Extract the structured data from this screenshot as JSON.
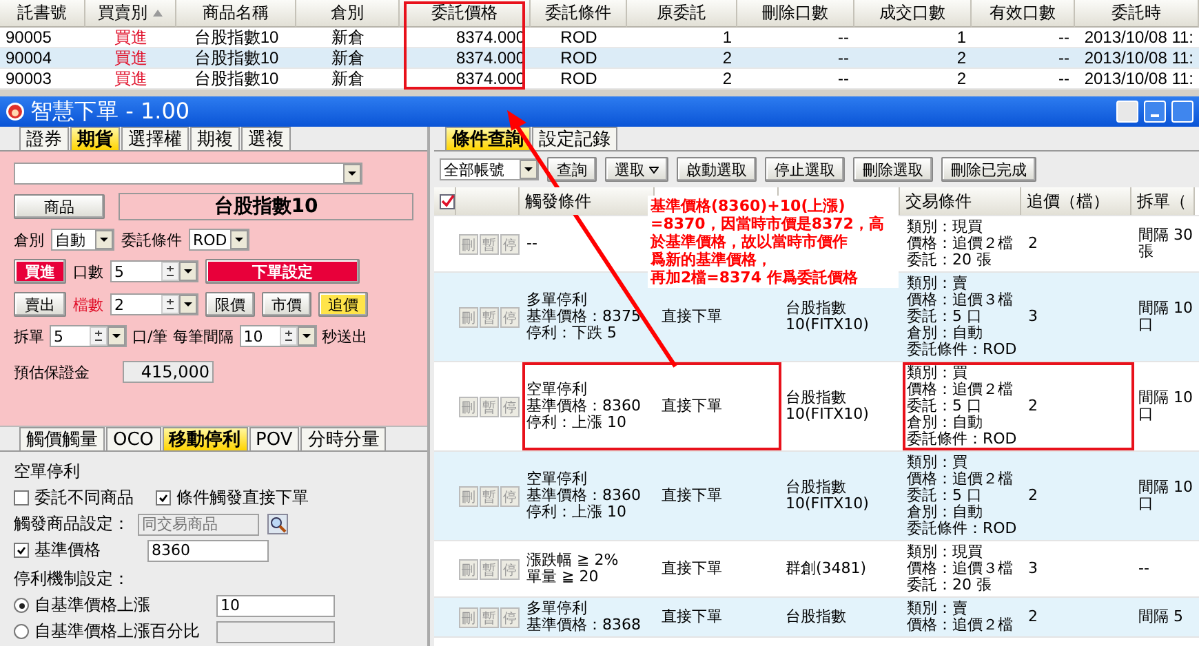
{
  "orders": {
    "columns": [
      {
        "label": "託書號",
        "highlighted": false,
        "sorted": false
      },
      {
        "label": "買賣別",
        "highlighted": false,
        "sorted": true
      },
      {
        "label": "商品名稱",
        "highlighted": false,
        "sorted": false
      },
      {
        "label": "倉別",
        "highlighted": false,
        "sorted": false
      },
      {
        "label": "委託價格",
        "highlighted": true,
        "sorted": false
      },
      {
        "label": "委託條件",
        "highlighted": false,
        "sorted": false
      },
      {
        "label": "原委託",
        "highlighted": false,
        "sorted": false
      },
      {
        "label": "刪除口數",
        "highlighted": false,
        "sorted": false
      },
      {
        "label": "成交口數",
        "highlighted": false,
        "sorted": false
      },
      {
        "label": "有效口數",
        "highlighted": false,
        "sorted": false
      },
      {
        "label": "委託時",
        "highlighted": false,
        "sorted": false
      }
    ],
    "rows": [
      {
        "selected": false,
        "cells": [
          "90005",
          "買進",
          "台股指數10",
          "新倉",
          "8374.000",
          "ROD",
          "1",
          "--",
          "1",
          "--",
          "2013/10/08 11:"
        ]
      },
      {
        "selected": true,
        "cells": [
          "90004",
          "買進",
          "台股指數10",
          "新倉",
          "8374.000",
          "ROD",
          "2",
          "--",
          "2",
          "--",
          "2013/10/08 11:"
        ]
      },
      {
        "selected": false,
        "cells": [
          "90003",
          "買進",
          "台股指數10",
          "新倉",
          "8374.000",
          "ROD",
          "2",
          "--",
          "2",
          "--",
          "2013/10/08 11:"
        ]
      }
    ]
  },
  "window": {
    "title": "智慧下單 - 1.00"
  },
  "order_panel": {
    "tabs": [
      {
        "label": "證券",
        "selected": false
      },
      {
        "label": "期貨",
        "selected": true
      },
      {
        "label": "選擇權",
        "selected": false
      },
      {
        "label": "期複",
        "selected": false
      },
      {
        "label": "選複",
        "selected": false
      }
    ],
    "product_button": "商品",
    "product_name": "台股指數10",
    "position": {
      "label": "倉別",
      "value": "自動"
    },
    "condition": {
      "label": "委託條件",
      "value": "ROD"
    },
    "sides": [
      {
        "label": "買進",
        "selected": true
      },
      {
        "label": "賣出",
        "selected": false
      }
    ],
    "quantity": {
      "label": "口數",
      "value": "5"
    },
    "ticks": {
      "label": "檔數",
      "value": "2"
    },
    "order_settings_button": "下單設定",
    "price_types": [
      {
        "label": "限價",
        "selected": false
      },
      {
        "label": "市價",
        "selected": false
      },
      {
        "label": "追價",
        "selected": true
      }
    ],
    "split": {
      "label": "拆單",
      "value": "5",
      "unit": "口/筆",
      "interval_label": "每筆間隔",
      "interval": "10",
      "interval_unit": "秒送出"
    },
    "margin": {
      "label": "預估保證金",
      "value": "415,000"
    }
  },
  "strategy_panel": {
    "tabs": [
      {
        "label": "觸價觸量",
        "selected": false
      },
      {
        "label": "OCO",
        "selected": false
      },
      {
        "label": "移動停利",
        "selected": true
      },
      {
        "label": "POV",
        "selected": false
      },
      {
        "label": "分時分量",
        "selected": false
      }
    ],
    "title": "空單停利",
    "checks": [
      {
        "label": "委託不同商品",
        "checked": false
      },
      {
        "label": "條件觸發直接下單",
        "checked": true
      }
    ],
    "trigger_product": {
      "label": "觸發商品設定：",
      "placeholder": "同交易商品"
    },
    "base_price": {
      "label": "基準價格",
      "checked": true,
      "value": "8360"
    },
    "mechanism_label": "停利機制設定：",
    "options": [
      {
        "label": "自基準價格上漲",
        "selected": true,
        "value": "10"
      },
      {
        "label": "自基準價格上漲百分比",
        "selected": false
      }
    ]
  },
  "query_panel": {
    "tabs": [
      {
        "label": "條件查詢",
        "selected": true
      },
      {
        "label": "設定記錄",
        "selected": false
      }
    ],
    "account_filter": "全部帳號",
    "buttons": [
      {
        "label": "查詢",
        "kind": "plain"
      },
      {
        "label": "選取",
        "kind": "menu"
      },
      {
        "label": "啟動選取",
        "kind": "plain"
      },
      {
        "label": "停止選取",
        "kind": "plain"
      },
      {
        "label": "刪除選取",
        "kind": "plain"
      },
      {
        "label": "刪除已完成",
        "kind": "plain"
      }
    ],
    "select_all": true,
    "columns": [
      {
        "label": "觸發條件"
      },
      {},
      {},
      {
        "label": "交易條件"
      },
      {
        "label": "追價（檔）"
      },
      {
        "label": "拆單（"
      }
    ],
    "rows": [
      {
        "actions": [
          "刪",
          "暫",
          "停"
        ],
        "trigger": [
          "--"
        ],
        "trade": [
          "類別：現買",
          "價格：追價２檔",
          "委託：20 張"
        ],
        "chase": "2",
        "split": [
          "間隔 30",
          "張"
        ],
        "trigger_boxed": false,
        "trade_boxed": false
      },
      {
        "actions": [
          "刪",
          "暫",
          "停"
        ],
        "trigger": [
          "多單停利",
          "基準價格：8375",
          "停利：下跌 5"
        ],
        "method": "直接下單",
        "product": [
          "台股指數",
          "10(FITX10)"
        ],
        "trade": [
          "類別：賣",
          "價格：追價３檔",
          "委託：5 口",
          "倉別：自動",
          "委託條件：ROD"
        ],
        "chase": "3",
        "split": [
          "間隔 10",
          "口"
        ],
        "trigger_boxed": false,
        "trade_boxed": false
      },
      {
        "actions": [
          "刪",
          "暫",
          "停"
        ],
        "trigger": [
          "空單停利",
          "基準價格：8360",
          "停利：上漲 10"
        ],
        "method": "直接下單",
        "product": [
          "台股指數",
          "10(FITX10)"
        ],
        "trade": [
          "類別：買",
          "價格：追價２檔",
          "委託：5 口",
          "倉別：自動",
          "委託條件：ROD"
        ],
        "chase": "2",
        "split": [
          "間隔 10",
          "口"
        ],
        "trigger_boxed": true,
        "trade_boxed": true
      },
      {
        "actions": [
          "刪",
          "暫",
          "停"
        ],
        "trigger": [
          "空單停利",
          "基準價格：8360",
          "停利：上漲 10"
        ],
        "method": "直接下單",
        "product": [
          "台股指數",
          "10(FITX10)"
        ],
        "trade": [
          "類別：買",
          "價格：追價２檔",
          "委託：5 口",
          "倉別：自動",
          "委託條件：ROD"
        ],
        "chase": "2",
        "split": [
          "間隔 10",
          "口"
        ],
        "trigger_boxed": false,
        "trade_boxed": false
      },
      {
        "actions": [
          "刪",
          "暫",
          "停"
        ],
        "trigger": [
          "漲跌幅 ≧ 2%",
          "單量 ≧ 20"
        ],
        "method": "直接下單",
        "product": [
          "群創(3481)"
        ],
        "trade": [
          "類別：現買",
          "價格：追價３檔",
          "委託：20 張"
        ],
        "chase": "3",
        "split": [
          "--"
        ],
        "trigger_boxed": false,
        "trade_boxed": false
      },
      {
        "actions": [
          "刪",
          "暫",
          "停"
        ],
        "trigger": [
          "多單停利",
          "基準價格：8368"
        ],
        "method": "直接下單",
        "product": [
          "台股指數"
        ],
        "trade": [
          "類別：賣",
          "價格：追價２檔"
        ],
        "chase": "2",
        "split": [
          "間隔 5"
        ],
        "trigger_boxed": false,
        "trade_boxed": false
      }
    ]
  },
  "annotation": {
    "lines": [
      "基準價格(8360)+10(上漲)",
      "=8370，因當時市價是8372，高",
      "於基準價格，故以當時市價作",
      "爲新的基準價格，",
      "再加2檔=8374  作爲委託價格"
    ]
  }
}
